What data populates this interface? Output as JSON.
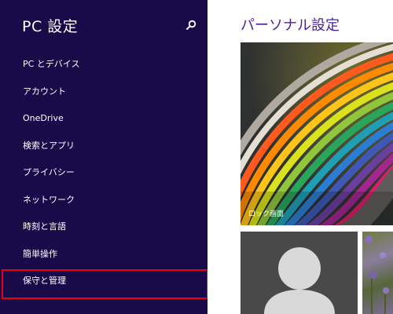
{
  "nav": {
    "title": "PC 設定",
    "search_icon": "search-icon",
    "items": [
      {
        "label": "PC とデバイス"
      },
      {
        "label": "アカウント"
      },
      {
        "label": "OneDrive"
      },
      {
        "label": "検索とアプリ"
      },
      {
        "label": "プライバシー"
      },
      {
        "label": "ネットワーク"
      },
      {
        "label": "時刻と言語"
      },
      {
        "label": "簡単操作"
      },
      {
        "label": "保守と管理",
        "selected": true
      }
    ]
  },
  "content": {
    "title": "パーソナル設定",
    "lock_screen_label": "ロック画面"
  },
  "colors": {
    "nav_background": "#190a4a",
    "content_title": "#4b1e9a",
    "highlight_border": "#e60012",
    "account_tile": "#494949",
    "avatar": "#d9d9d9"
  }
}
